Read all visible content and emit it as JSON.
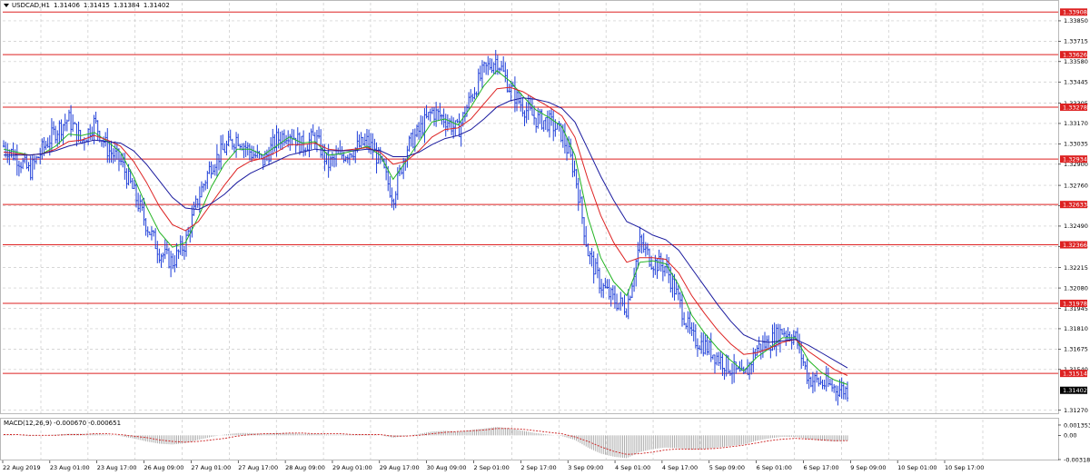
{
  "chart_header": {
    "symbol": "USDCAD,H1",
    "open": "1.31406",
    "high": "1.31415",
    "low": "1.31384",
    "close": "1.31402"
  },
  "macd_header": {
    "label": "MACD(12,26,9)",
    "main": "-0.000670",
    "signal": "-0.000651"
  },
  "colors": {
    "candle": "#1f3fd8",
    "ma_fast": "#22b422",
    "ma_mid": "#dd2222",
    "ma_slow": "#1a1a9e",
    "level_line": "#dd2222",
    "level_tag": "#dd2222",
    "grid": "#c8c8c8",
    "macd_hist": "#9a9a9a",
    "macd_signal": "#cc2222"
  },
  "chart_data": {
    "type": "candlestick",
    "title": "",
    "ylim": [
      1.3125,
      1.3397
    ],
    "y_ticks": [
      "1.33850",
      "1.33715",
      "1.33580",
      "1.33445",
      "1.33305",
      "1.33170",
      "1.33035",
      "1.32900",
      "1.32760",
      "1.32625",
      "1.32490",
      "1.32355",
      "1.32215",
      "1.32080",
      "1.31945",
      "1.31810",
      "1.31675",
      "1.31540",
      "1.31270"
    ],
    "x_labels": [
      "22 Aug 2019",
      "23 Aug 01:00",
      "23 Aug 17:00",
      "26 Aug 09:00",
      "27 Aug 01:00",
      "27 Aug 17:00",
      "28 Aug 09:00",
      "29 Aug 01:00",
      "29 Aug 17:00",
      "30 Aug 09:00",
      "2 Sep 01:00",
      "2 Sep 17:00",
      "3 Sep 09:00",
      "4 Sep 01:00",
      "4 Sep 17:00",
      "5 Sep 09:00",
      "6 Sep 01:00",
      "6 Sep 17:00",
      "9 Sep 09:00",
      "10 Sep 01:00",
      "10 Sep 17:00"
    ],
    "levels": [
      "1.33908",
      "1.33626",
      "1.33278",
      "1.32934",
      "1.32633",
      "1.32366",
      "1.31978",
      "1.31514"
    ],
    "current_price": "1.31402",
    "close_path": [
      1.3302,
      1.3295,
      1.3285,
      1.33,
      1.3312,
      1.332,
      1.3305,
      1.3318,
      1.33,
      1.3292,
      1.3272,
      1.325,
      1.3232,
      1.3225,
      1.3238,
      1.3268,
      1.329,
      1.33,
      1.3308,
      1.3298,
      1.3292,
      1.3306,
      1.3312,
      1.3302,
      1.3308,
      1.329,
      1.3296,
      1.33,
      1.3305,
      1.3292,
      1.3268,
      1.33,
      1.3312,
      1.3325,
      1.332,
      1.3312,
      1.3335,
      1.3352,
      1.336,
      1.334,
      1.3328,
      1.332,
      1.3318,
      1.331,
      1.3285,
      1.3232,
      1.321,
      1.32,
      1.3195,
      1.3238,
      1.3225,
      1.3222,
      1.32,
      1.3175,
      1.317,
      1.3162,
      1.3155,
      1.3148,
      1.3168,
      1.3172,
      1.318,
      1.3175,
      1.3148,
      1.3145,
      1.3142,
      1.314
    ],
    "ma_fast": [
      1.33,
      1.3298,
      1.3296,
      1.3297,
      1.3302,
      1.331,
      1.3309,
      1.3311,
      1.3305,
      1.3298,
      1.3282,
      1.3262,
      1.3245,
      1.3235,
      1.3238,
      1.3255,
      1.3275,
      1.329,
      1.33,
      1.33,
      1.3296,
      1.3302,
      1.3308,
      1.3304,
      1.3305,
      1.3296,
      1.3297,
      1.3299,
      1.3302,
      1.3296,
      1.328,
      1.3292,
      1.3305,
      1.3318,
      1.332,
      1.3316,
      1.3328,
      1.3342,
      1.3352,
      1.3345,
      1.3335,
      1.3326,
      1.3321,
      1.3315,
      1.3296,
      1.3255,
      1.3228,
      1.3212,
      1.3203,
      1.3225,
      1.3226,
      1.3224,
      1.321,
      1.319,
      1.3178,
      1.3168,
      1.316,
      1.3153,
      1.3162,
      1.3168,
      1.3175,
      1.3175,
      1.316,
      1.3152,
      1.3147,
      1.3144
    ],
    "ma_mid": [
      1.3298,
      1.3297,
      1.3296,
      1.3297,
      1.33,
      1.3305,
      1.3306,
      1.3309,
      1.3306,
      1.3302,
      1.3292,
      1.3278,
      1.3262,
      1.325,
      1.3246,
      1.3252,
      1.3264,
      1.3276,
      1.3287,
      1.3292,
      1.3294,
      1.3298,
      1.3303,
      1.3303,
      1.3304,
      1.33,
      1.3299,
      1.33,
      1.3301,
      1.3298,
      1.329,
      1.3292,
      1.3299,
      1.3308,
      1.3313,
      1.3314,
      1.332,
      1.333,
      1.334,
      1.3341,
      1.3338,
      1.3333,
      1.3328,
      1.3322,
      1.3308,
      1.328,
      1.3256,
      1.3238,
      1.3225,
      1.3228,
      1.3228,
      1.3227,
      1.3218,
      1.3203,
      1.3191,
      1.318,
      1.3171,
      1.3164,
      1.3165,
      1.3168,
      1.3172,
      1.3174,
      1.3166,
      1.316,
      1.3154,
      1.315
    ],
    "ma_slow": [
      1.3296,
      1.3296,
      1.3296,
      1.3297,
      1.3299,
      1.3302,
      1.3304,
      1.3306,
      1.3305,
      1.3304,
      1.3299,
      1.329,
      1.3279,
      1.3268,
      1.3261,
      1.326,
      1.3264,
      1.327,
      1.3278,
      1.3284,
      1.3288,
      1.3292,
      1.3296,
      1.3298,
      1.33,
      1.3299,
      1.3299,
      1.3299,
      1.33,
      1.3299,
      1.3295,
      1.3295,
      1.3298,
      1.3303,
      1.3307,
      1.3309,
      1.3313,
      1.332,
      1.3328,
      1.3332,
      1.3334,
      1.3333,
      1.3331,
      1.3327,
      1.3318,
      1.33,
      1.3282,
      1.3266,
      1.3252,
      1.3248,
      1.3243,
      1.324,
      1.3233,
      1.3221,
      1.3209,
      1.3197,
      1.3186,
      1.3177,
      1.3173,
      1.3172,
      1.3173,
      1.3174,
      1.317,
      1.3165,
      1.316,
      1.3155
    ],
    "macd": {
      "ylim": [
        -0.00318,
        0.00135
      ],
      "y_ticks": [
        "0.001353",
        "0.00",
        "-0.00318"
      ],
      "hist": [
        0.0001,
        0.0,
        -0.0001,
        0.0,
        0.0001,
        0.0002,
        0.0002,
        0.0002,
        0.0001,
        -0.0001,
        -0.0004,
        -0.0008,
        -0.0011,
        -0.0012,
        -0.001,
        -0.0006,
        -0.0002,
        0.0001,
        0.0003,
        0.0003,
        0.0002,
        0.0003,
        0.0003,
        0.0002,
        0.0002,
        0.0001,
        0.0001,
        0.0001,
        0.0001,
        0.0,
        -0.0003,
        -0.0001,
        0.0002,
        0.0005,
        0.0006,
        0.0005,
        0.0007,
        0.0009,
        0.0011,
        0.0009,
        0.0006,
        0.0003,
        0.0001,
        -0.0001,
        -0.0006,
        -0.0016,
        -0.0024,
        -0.0028,
        -0.003,
        -0.0022,
        -0.0018,
        -0.0016,
        -0.0017,
        -0.0019,
        -0.0018,
        -0.0016,
        -0.0014,
        -0.0012,
        -0.0007,
        -0.0004,
        -0.0002,
        -0.0002,
        -0.0005,
        -0.0007,
        -0.0008,
        -0.0007
      ],
      "signal": [
        0.0001,
        0.0001,
        0.0,
        0.0,
        0.0,
        0.0001,
        0.0001,
        0.0002,
        0.0002,
        0.0001,
        -0.0001,
        -0.0003,
        -0.0006,
        -0.0008,
        -0.0009,
        -0.0008,
        -0.0006,
        -0.0004,
        -0.0001,
        0.0001,
        0.0002,
        0.0002,
        0.0003,
        0.0003,
        0.0002,
        0.0002,
        0.0002,
        0.0001,
        0.0001,
        0.0001,
        -0.0001,
        -0.0001,
        0.0,
        0.0002,
        0.0004,
        0.0005,
        0.0006,
        0.0007,
        0.0009,
        0.0009,
        0.0008,
        0.0006,
        0.0004,
        0.0002,
        -0.0002,
        -0.0008,
        -0.0015,
        -0.0021,
        -0.0025,
        -0.0024,
        -0.0022,
        -0.0019,
        -0.0018,
        -0.0018,
        -0.0018,
        -0.0017,
        -0.0015,
        -0.0013,
        -0.001,
        -0.0007,
        -0.0005,
        -0.0004,
        -0.0005,
        -0.0006,
        -0.0007,
        -0.0007
      ]
    }
  }
}
